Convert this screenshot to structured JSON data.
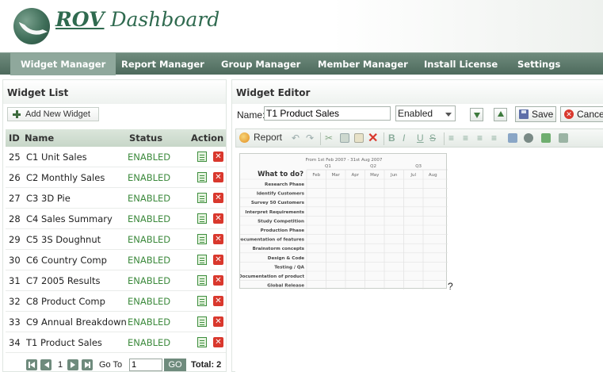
{
  "header": {
    "brand_strong": "ROV",
    "brand_rest": "Dashboard"
  },
  "nav": {
    "items": [
      "Widget Manager",
      "Report Manager",
      "Group Manager",
      "Member Manager",
      "Install License",
      "Settings"
    ],
    "active": "Widget Manager"
  },
  "widget_list": {
    "title": "Widget List",
    "add_label": "Add New Widget",
    "columns": {
      "id": "ID",
      "name": "Name",
      "status": "Status",
      "action": "Action"
    },
    "rows": [
      {
        "id": "25",
        "name": "C1 Unit Sales",
        "status": "ENABLED"
      },
      {
        "id": "26",
        "name": "C2 Monthly Sales",
        "status": "ENABLED"
      },
      {
        "id": "27",
        "name": "C3 3D Pie",
        "status": "ENABLED"
      },
      {
        "id": "28",
        "name": "C4 Sales Summary",
        "status": "ENABLED"
      },
      {
        "id": "29",
        "name": "C5 3S Doughnut",
        "status": "ENABLED"
      },
      {
        "id": "30",
        "name": "C6 Country Comp",
        "status": "ENABLED"
      },
      {
        "id": "31",
        "name": "C7 2005 Results",
        "status": "ENABLED"
      },
      {
        "id": "32",
        "name": "C8 Product Comp",
        "status": "ENABLED"
      },
      {
        "id": "33",
        "name": "C9 Annual Breakdown",
        "status": "ENABLED"
      },
      {
        "id": "34",
        "name": "T1 Product Sales",
        "status": "ENABLED"
      }
    ],
    "pager": {
      "page": "1",
      "goto_label": "Go To",
      "goto_value": "1",
      "go_label": "GO",
      "total_label": "Total: 2"
    }
  },
  "editor": {
    "title": "Widget Editor",
    "name_label": "Name:",
    "name_value": "T1 Product Sales",
    "status_value": "Enabled",
    "save_label": "Save",
    "cancel_label": "Cancel",
    "toolbar": {
      "report_label": "Report",
      "bold": "B",
      "italic": "I",
      "underline": "U",
      "strike": "S",
      "icons": [
        "report-icon",
        "undo-icon",
        "redo-icon",
        "cut-icon",
        "copy-icon",
        "paste-icon",
        "delete-icon",
        "bold-icon",
        "italic-icon",
        "underline-icon",
        "strikethrough-icon",
        "align-left-icon",
        "align-center-icon",
        "align-right-icon",
        "justify-icon",
        "image-icon",
        "print-icon",
        "color-icon",
        "link-icon"
      ]
    },
    "cursor_text": "?",
    "gantt": {
      "subtitle": "From 1st Feb 2007 - 31st Aug 2007",
      "heading": "What to do?",
      "quarters": [
        "Q1",
        "Q2",
        "Q3"
      ],
      "months": [
        "Feb",
        "Mar",
        "Apr",
        "May",
        "Jun",
        "Jul",
        "Aug"
      ],
      "tasks": [
        "Research Phase",
        "Identify Customers",
        "Survey 50 Customers",
        "Interpret Requirements",
        "Study Competition",
        "Production Phase",
        "Documentation of features",
        "Brainstorm concepts",
        "Design & Code",
        "Testing / QA",
        "Documentation of product",
        "Global Release"
      ]
    }
  },
  "colors": {
    "nav_bg": "#4d6a5c",
    "nav_active": "#8fa89c",
    "enabled_text": "#3d8a3d",
    "delete_red": "#d9382d",
    "brand_green": "#2f6a4f"
  }
}
